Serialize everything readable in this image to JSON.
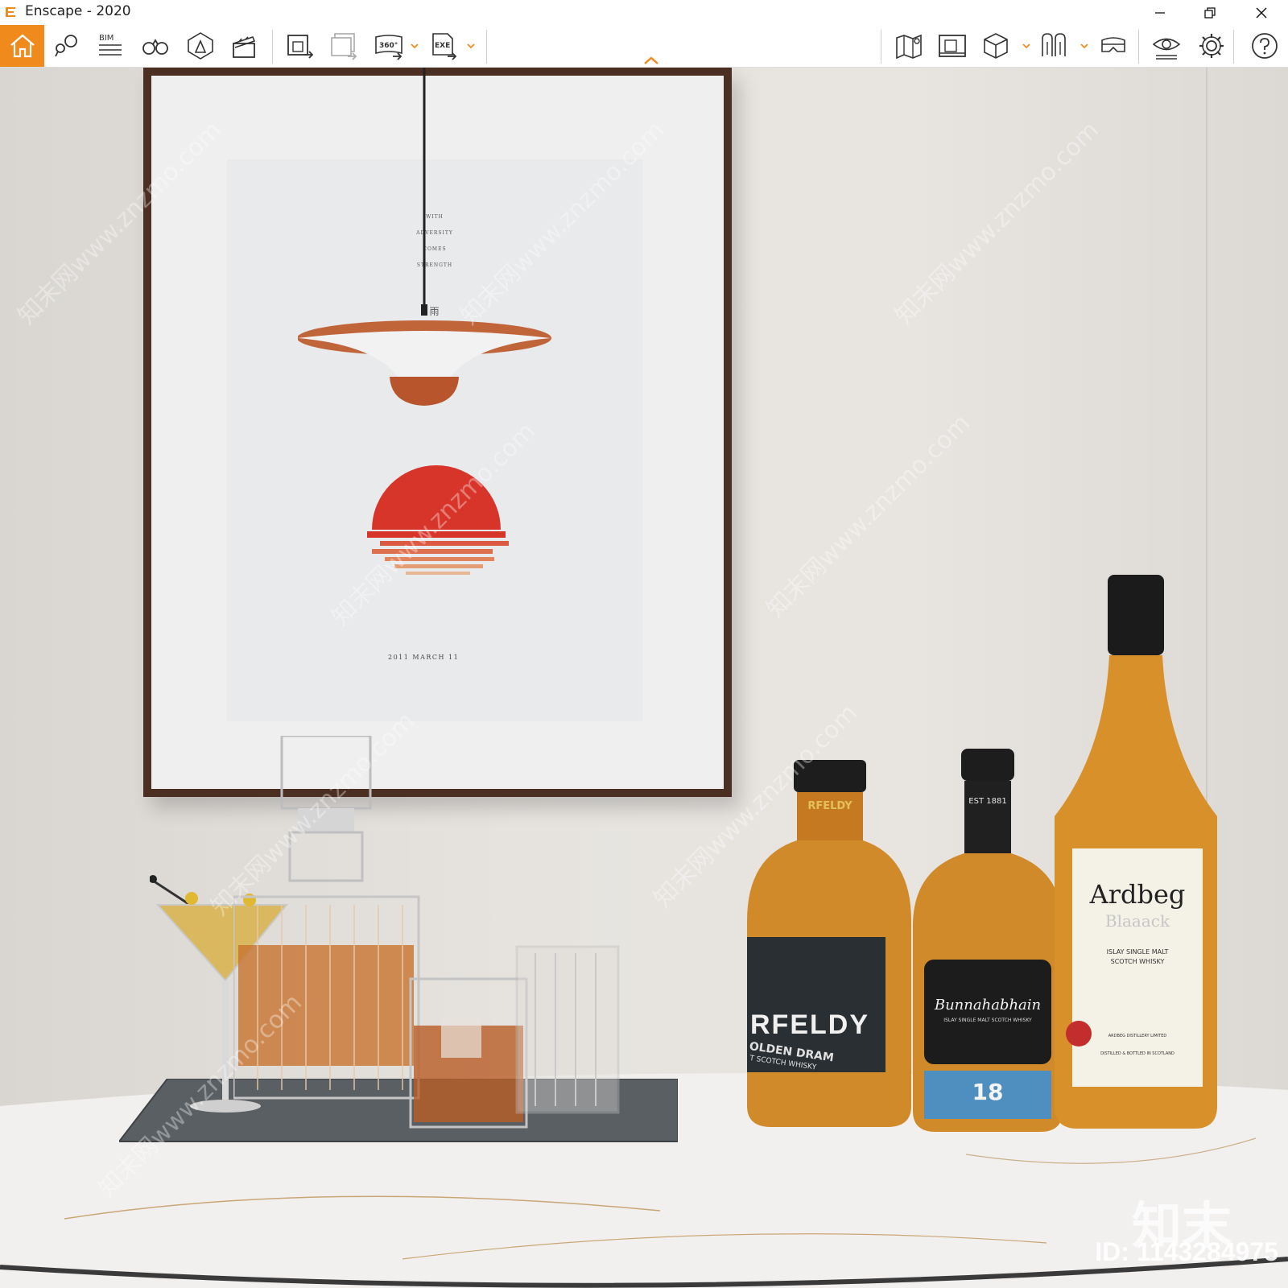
{
  "window": {
    "title": "Enscape - 2020",
    "controls": {
      "minimize": "minimize-icon",
      "restore": "restore-icon",
      "close": "close-icon"
    }
  },
  "toolbar": {
    "accent_color": "#f08a1c",
    "bim_label": "BIM",
    "panorama_label": "360°",
    "exe_label": "EXE",
    "left_tools": [
      "home-icon",
      "location-pins-icon",
      "bim-list-icon",
      "binoculars-icon",
      "atmosphere-icon",
      "clapperboard-icon",
      "export-image-icon",
      "batch-render-icon",
      "panorama-icon",
      "export-exe-icon"
    ],
    "right_tools": [
      "map-icon",
      "video-editor-icon",
      "asset-library-cube-icon",
      "material-editor-icon",
      "vr-headset-icon",
      "visual-settings-eye-icon",
      "settings-gear-icon",
      "help-icon"
    ]
  },
  "scene": {
    "poster_text_lines": [
      "WITH",
      "ADVERSITY",
      "COMES",
      "STRENGTH"
    ],
    "poster_glyph": "雨",
    "poster_date": "2011 MARCH 11",
    "bottle_labels": {
      "left": {
        "brand": "RFELDY",
        "line1": "OLDEN DRAM",
        "line2": "T SCOTCH WHISKY",
        "neck": "RFELDY"
      },
      "middle": {
        "brand": "Bunnahabhain",
        "sub": "ISLAY SINGLE MALT SCOTCH WHISKY",
        "neck": "EST 1881",
        "age": "18"
      },
      "right": {
        "brand": "Ardbeg",
        "sub": "Blaaack",
        "line1": "ISLAY SINGLE MALT",
        "line2": "SCOTCH WHISKY",
        "distillery": "ARDBEG DISTILLERY LIMITED",
        "place": "DISTILLED & BOTTLED IN SCOTLAND"
      }
    },
    "watermark_domain": "www.znzmo.com",
    "watermark_brand": "知末网",
    "watermark_logo": "知末",
    "watermark_id": "ID: 1143284975"
  }
}
